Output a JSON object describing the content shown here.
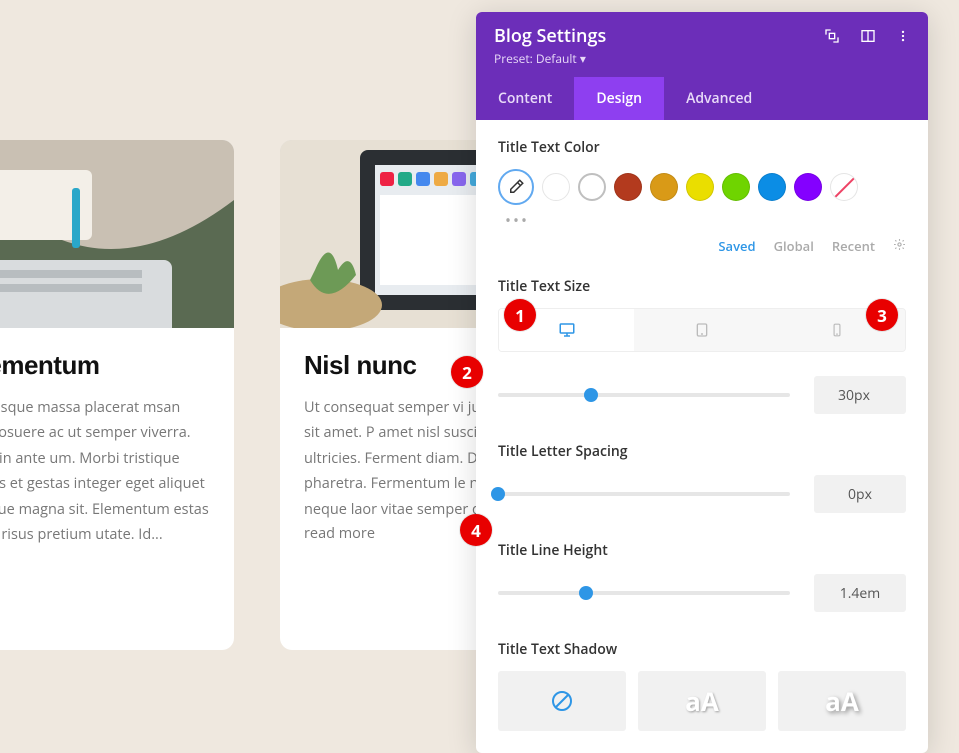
{
  "page": {
    "cards": [
      {
        "title": "s elementum",
        "text": "pellentesque massa placerat msan tortor posuere ac ut semper viverra. Feugiat in ante um. Morbi tristique senectus et gestas integer eget aliquet nibh tique magna sit. Elementum estas sed sed risus pretium utate. Id...",
        "readmore": ""
      },
      {
        "title": "Nisl nunc",
        "text": "Ut consequat semper vi justo laoreet sit amet. P amet nisl suscipit adipis est ultricies. Ferment diam. Donec enim di pharetra. Fermentum le non pulvinar neque laor vitae semper quis...",
        "readmore": "read more"
      }
    ]
  },
  "panel": {
    "title": "Blog Settings",
    "preset_label": "Preset: Default",
    "preset_caret": "▾",
    "tabs": {
      "content": "Content",
      "design": "Design",
      "advanced": "Advanced"
    },
    "sections": {
      "color_label": "Title Text Color",
      "filters": {
        "saved": "Saved",
        "global": "Global",
        "recent": "Recent"
      },
      "size_label": "Title Text Size",
      "size_value": "30px",
      "spacing_label": "Title Letter Spacing",
      "spacing_value": "0px",
      "lineheight_label": "Title Line Height",
      "lineheight_value": "1.4em",
      "shadow_label": "Title Text Shadow",
      "shadow_sample": "aA"
    },
    "colors": {
      "black": "#000000",
      "white": "#ffffff",
      "red": "#b33a1e",
      "orange": "#d99a17",
      "yellow": "#eade00",
      "green": "#6fd400",
      "blue": "#0b8de5",
      "purple": "#8400ff"
    }
  },
  "callouts": {
    "c1": "1",
    "c2": "2",
    "c3": "3",
    "c4": "4"
  }
}
